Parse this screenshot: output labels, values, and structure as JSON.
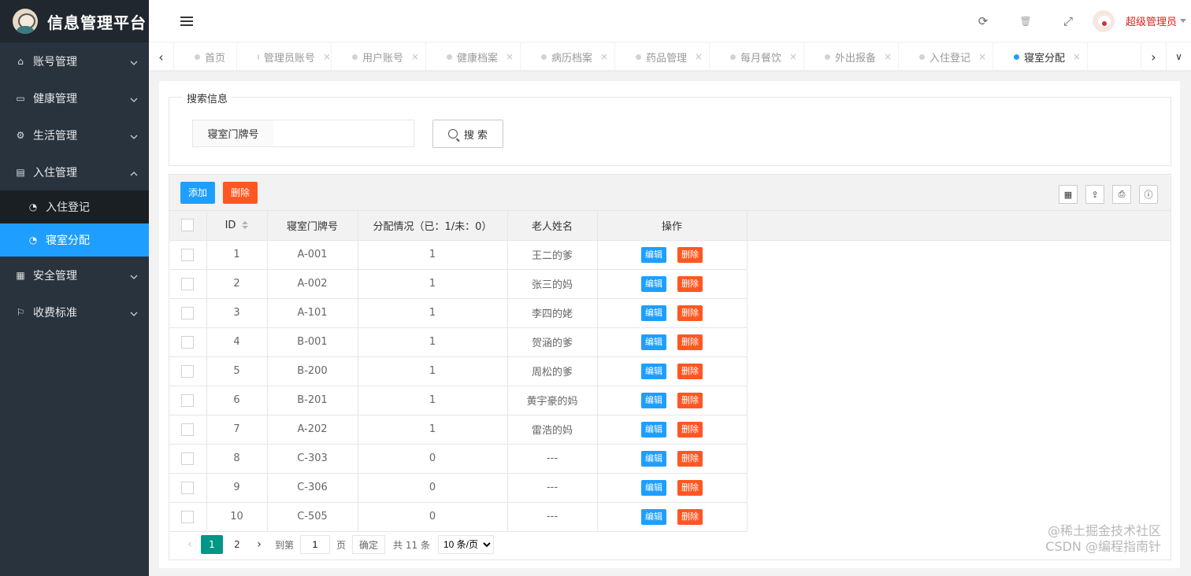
{
  "app": {
    "title": "信息管理平台"
  },
  "sidebar": {
    "items": [
      {
        "label": "账号管理",
        "icon": "home-icon",
        "glyph": "⌂"
      },
      {
        "label": "健康管理",
        "icon": "window-icon",
        "glyph": "▭"
      },
      {
        "label": "生活管理",
        "icon": "gears-icon",
        "glyph": "⚙"
      },
      {
        "label": "入住管理",
        "icon": "file-icon",
        "glyph": "▤",
        "expanded": true,
        "children": [
          {
            "label": "入住登记",
            "icon": "dashboard-icon",
            "glyph": "◔"
          },
          {
            "label": "寝室分配",
            "icon": "dashboard-icon",
            "glyph": "◔",
            "active": true
          }
        ]
      },
      {
        "label": "安全管理",
        "icon": "calendar-icon",
        "glyph": "▦"
      },
      {
        "label": "收费标准",
        "icon": "flag-icon",
        "glyph": "⚐"
      }
    ]
  },
  "header": {
    "user_name": "超级管理员",
    "icons": {
      "refresh": "⟳",
      "trash": "🗑",
      "fullscreen": "⤢"
    }
  },
  "tabs": {
    "items": [
      {
        "label": "首页",
        "closable": false
      },
      {
        "label": "管理员账号",
        "closable": true
      },
      {
        "label": "用户账号",
        "closable": true
      },
      {
        "label": "健康档案",
        "closable": true
      },
      {
        "label": "病历档案",
        "closable": true
      },
      {
        "label": "药品管理",
        "closable": true
      },
      {
        "label": "每月餐饮",
        "closable": true
      },
      {
        "label": "外出报备",
        "closable": true
      },
      {
        "label": "入住登记",
        "closable": true
      },
      {
        "label": "寝室分配",
        "closable": true,
        "active": true
      }
    ],
    "close_glyph": "×"
  },
  "search": {
    "legend": "搜索信息",
    "label": "寝室门牌号",
    "value": "",
    "button": "搜 索"
  },
  "toolbar": {
    "add": "添加",
    "delete": "删除"
  },
  "table": {
    "headers": {
      "id": "ID",
      "room": "寝室门牌号",
      "alloc": "分配情况（已：1/未：0）",
      "name": "老人姓名",
      "ops": "操作"
    },
    "edit_label": "编辑",
    "delete_label": "删除",
    "rows": [
      {
        "id": "1",
        "room": "A-001",
        "alloc": "1",
        "name": "王二的爹"
      },
      {
        "id": "2",
        "room": "A-002",
        "alloc": "1",
        "name": "张三的妈"
      },
      {
        "id": "3",
        "room": "A-101",
        "alloc": "1",
        "name": "李四的姥"
      },
      {
        "id": "4",
        "room": "B-001",
        "alloc": "1",
        "name": "贺涵的爹"
      },
      {
        "id": "5",
        "room": "B-200",
        "alloc": "1",
        "name": "周松的爹"
      },
      {
        "id": "6",
        "room": "B-201",
        "alloc": "1",
        "name": "黄宇豪的妈"
      },
      {
        "id": "7",
        "room": "A-202",
        "alloc": "1",
        "name": "雷浩的妈"
      },
      {
        "id": "8",
        "room": "C-303",
        "alloc": "0",
        "name": "---"
      },
      {
        "id": "9",
        "room": "C-306",
        "alloc": "0",
        "name": "---"
      },
      {
        "id": "10",
        "room": "C-505",
        "alloc": "0",
        "name": "---"
      }
    ]
  },
  "pager": {
    "pages": [
      "1",
      "2"
    ],
    "current": "1",
    "goto_prefix": "到第",
    "goto_value": "1",
    "goto_suffix": "页",
    "ok": "确定",
    "total": "共 11 条",
    "page_size": "10 条/页"
  },
  "watermark": {
    "line1": "@稀土掘金技术社区",
    "line2": "CSDN @编程指南针"
  },
  "colors": {
    "sidebar_bg": "#28333e",
    "logo_bg": "#20272f",
    "active_blue": "#1e9fff",
    "danger_orange": "#ff5722",
    "pager_active": "#009688",
    "user_name_red": "#e02020"
  }
}
